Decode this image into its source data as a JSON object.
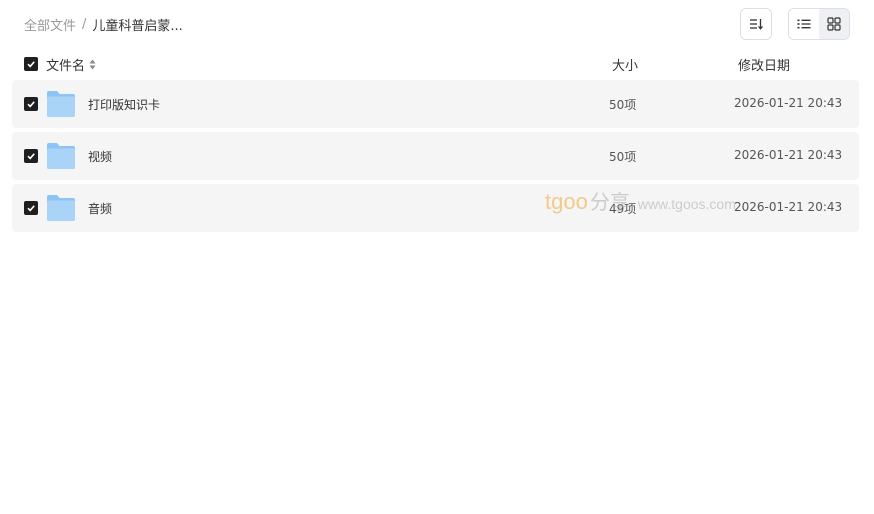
{
  "breadcrumb": {
    "root": "全部文件",
    "separator": "/",
    "current": "儿童科普启蒙..."
  },
  "toolbar": {
    "sort_icon": "sort-lines-icon",
    "view_list_icon": "list-view-icon",
    "view_grid_icon": "grid-view-icon",
    "active_view": "list"
  },
  "table": {
    "headers": {
      "name": "文件名",
      "size": "大小",
      "date": "修改日期"
    },
    "rows": [
      {
        "name": "打印版知识卡",
        "size": "50项",
        "date": "2026-01-21 20:43",
        "checked": true,
        "icon": "folder-icon"
      },
      {
        "name": "视频",
        "size": "50项",
        "date": "2026-01-21 20:43",
        "checked": true,
        "icon": "folder-icon"
      },
      {
        "name": "音频",
        "size": "49项",
        "date": "2026-01-21 20:43",
        "checked": true,
        "icon": "folder-icon"
      }
    ]
  },
  "watermark": {
    "logo": "tgoo",
    "cn": "分享",
    "url": "www.tgoos.com"
  },
  "colors": {
    "row_bg": "#f5f5f5",
    "checkbox": "#1f1f1f",
    "folder": "#7ab8f0"
  }
}
